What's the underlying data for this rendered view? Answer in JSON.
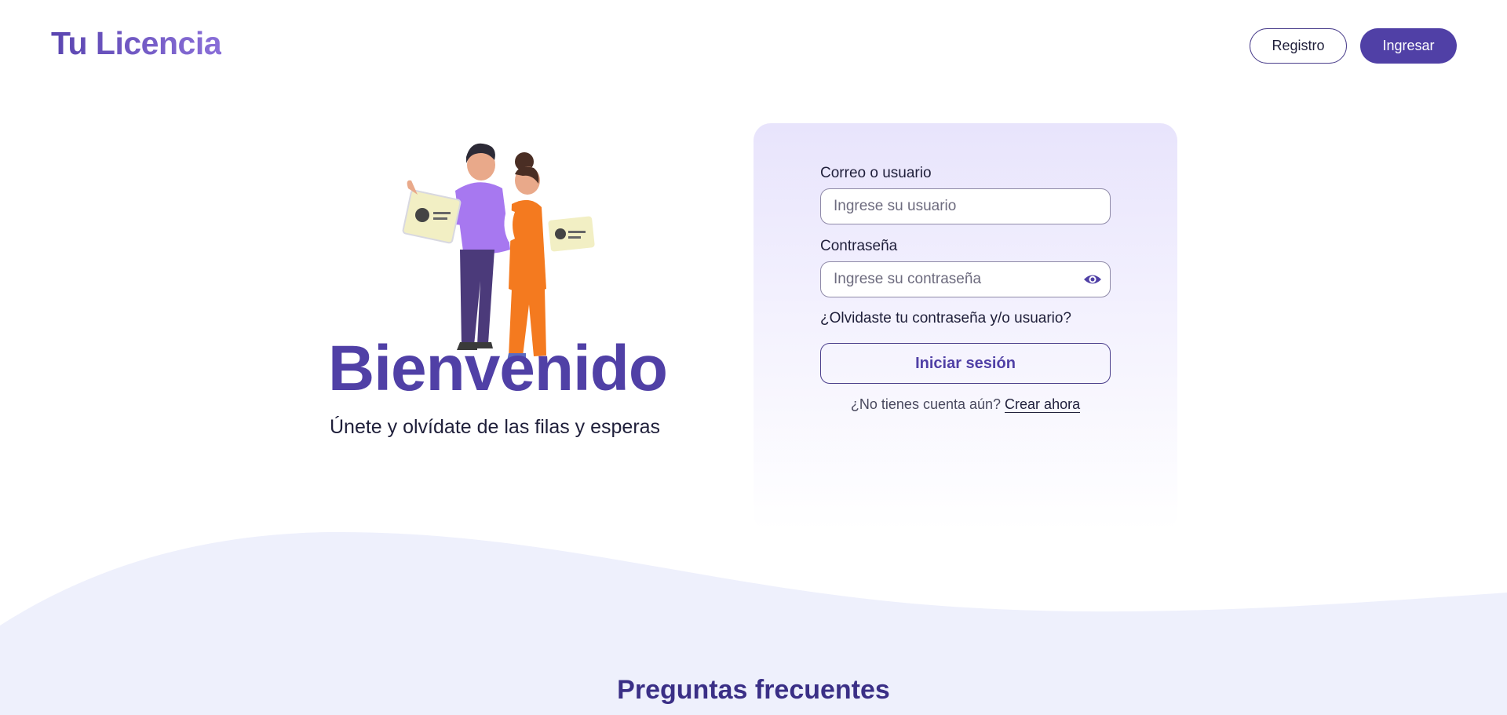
{
  "header": {
    "logo": "Tu Licencia",
    "register_label": "Registro",
    "login_label": "Ingresar"
  },
  "hero": {
    "title": "Bienvenido",
    "subtitle": "Únete y olvídate de las filas y esperas"
  },
  "login_form": {
    "user_label": "Correo o usuario",
    "user_placeholder": "Ingrese su usuario",
    "password_label": "Contraseña",
    "password_placeholder": "Ingrese su contraseña",
    "forgot_text": "¿Olvidaste tu contraseña y/o usuario?",
    "submit_label": "Iniciar sesión",
    "signup_prompt": "¿No tienes cuenta aún?",
    "signup_link": "Crear ahora"
  },
  "faq": {
    "title": "Preguntas frecuentes"
  },
  "colors": {
    "primary": "#5040a6",
    "card_tint": "#e8e4fc",
    "wave": "#eef0fc"
  },
  "icons": {
    "password_toggle": "eye-icon"
  }
}
